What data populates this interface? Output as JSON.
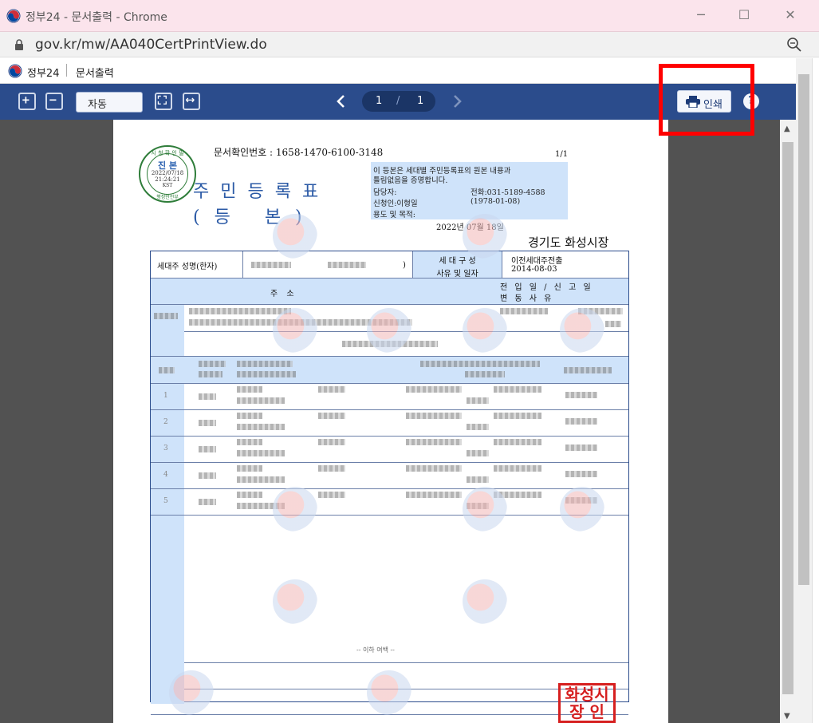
{
  "window": {
    "title": "정부24 - 문서출력 - Chrome",
    "url": "gov.kr/mw/AA040CertPrintView.do"
  },
  "page_header": {
    "brand": "정부24",
    "subtitle": "문서출력"
  },
  "toolbar": {
    "zoom_value": "자동",
    "current_page": "1",
    "page_separator": "/",
    "total_pages": "1",
    "print_label": "인쇄",
    "help_label": "?"
  },
  "document": {
    "certificate_number": "문서확인번호 : 1658-1470-6100-3148",
    "page_indicator": "1/1",
    "title_line1": "주민등록표",
    "title_line2": "(등    본)",
    "stamp": {
      "top": "시 청 확 인 필",
      "middle": "진 본",
      "date": "2022/07/18",
      "time": "21:24:21",
      "tz": "KST",
      "bottom": "행정안전부"
    },
    "info_box": {
      "line1": "이 등본은 세대별 주민등록표의 원본 내용과",
      "line2": "틀림없음을 증명합니다.",
      "contact_label": "담당자:",
      "phone": "전화:031-5189-4588",
      "applicant": "신청인:이형일",
      "applicant_birth": "(1978-01-08)",
      "purpose": "용도 및 목적:"
    },
    "issue_date": "2022년 07월 18일",
    "issuer": "경기도 화성시장",
    "table_header": {
      "householder": "세대주 성명(한자)",
      "composition_label1": "세 대 구 성",
      "composition_label2": "사유 및 일자",
      "composition_value1": "이전세대주전출",
      "composition_value2": "2014-08-03",
      "address_col": "주                소",
      "date_col1": "전 입 일 / 신 고 일",
      "date_col2": "변 동          사 유"
    },
    "member_rows": [
      "1",
      "2",
      "3",
      "4",
      "5"
    ],
    "end_marker": "-- 이하 여백 --",
    "seal": "화성시 장 인"
  }
}
